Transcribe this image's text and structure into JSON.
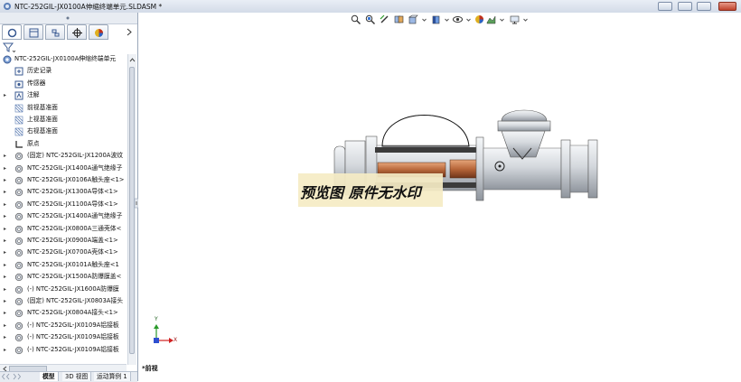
{
  "window": {
    "title": "NTC-252GIL-JX0100A伸缩终端单元.SLDASM *"
  },
  "panel": {
    "root_label": "NTC-252GIL-JX0100A伸缩终端单元",
    "items": [
      {
        "label": "历史记录",
        "icon": "history-icon",
        "arrow": ""
      },
      {
        "label": "传感器",
        "icon": "sensor-icon",
        "arrow": ""
      },
      {
        "label": "注解",
        "icon": "annotation-icon",
        "arrow": "▸"
      },
      {
        "label": "前视基准面",
        "icon": "plane-icon",
        "arrow": ""
      },
      {
        "label": "上视基准面",
        "icon": "plane-icon",
        "arrow": ""
      },
      {
        "label": "右视基准面",
        "icon": "plane-icon",
        "arrow": ""
      },
      {
        "label": "原点",
        "icon": "origin-icon",
        "arrow": ""
      },
      {
        "label": "(固定) NTC-252GIL-JX1200A波纹",
        "icon": "part-icon",
        "arrow": "▸"
      },
      {
        "label": "NTC-252GIL-JX1400A通气绝缘子",
        "icon": "part-icon",
        "arrow": "▸"
      },
      {
        "label": "NTC-252GIL-JX0106A触头座<1>",
        "icon": "part-icon",
        "arrow": "▸"
      },
      {
        "label": "NTC-252GIL-JX1300A导体<1>",
        "icon": "part-icon",
        "arrow": "▸"
      },
      {
        "label": "NTC-252GIL-JX1100A导体<1>",
        "icon": "part-icon",
        "arrow": "▸"
      },
      {
        "label": "NTC-252GIL-JX1400A通气绝缘子",
        "icon": "part-icon",
        "arrow": "▸"
      },
      {
        "label": "NTC-252GIL-JX0800A三通壳体<",
        "icon": "part-icon",
        "arrow": "▸"
      },
      {
        "label": "NTC-252GIL-JX0900A端盖<1>",
        "icon": "part-icon",
        "arrow": "▸"
      },
      {
        "label": "NTC-252GIL-JX0700A壳体<1>",
        "icon": "part-icon",
        "arrow": "▸"
      },
      {
        "label": "NTC-252GIL-JX0101A触头座<1",
        "icon": "part-icon",
        "arrow": "▸"
      },
      {
        "label": "NTC-252GIL-JX1500A防爆膜盖<",
        "icon": "part-icon",
        "arrow": "▸"
      },
      {
        "label": "(-) NTC-252GIL-JX1600A防爆膜",
        "icon": "part-icon",
        "arrow": "▸"
      },
      {
        "label": "(固定) NTC-252GIL-JX0803A接头",
        "icon": "part-icon",
        "arrow": "▸"
      },
      {
        "label": "NTC-252GIL-JX0804A接头<1>",
        "icon": "part-icon",
        "arrow": "▸"
      },
      {
        "label": "(-) NTC-252GIL-JX0109A铝接板",
        "icon": "part-icon",
        "arrow": "▸"
      },
      {
        "label": "(-) NTC-252GIL-JX0109A铝接板",
        "icon": "part-icon",
        "arrow": "▸"
      },
      {
        "label": "(-) NTC-252GIL-JX0109A铝接板",
        "icon": "part-icon",
        "arrow": "▸"
      }
    ],
    "bottom_tabs": [
      "模型",
      "3D 视图",
      "运动算例 1"
    ]
  },
  "viewport": {
    "watermark": "预览图 原件无水印",
    "view_label": "*前视",
    "axis_x": "X",
    "axis_y": "Y"
  },
  "colors": {
    "titlebar": "#dde4ef",
    "copper": "#b8673a",
    "steel": "#c9cdd3",
    "watermark_bg": "#f5ecc4"
  }
}
